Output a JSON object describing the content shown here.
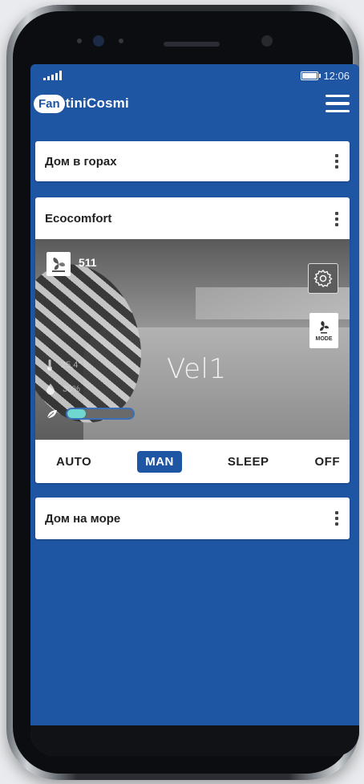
{
  "status_bar": {
    "time": "12:06"
  },
  "app": {
    "logo_badge": "Fan",
    "logo_rest": "tiniCosmi"
  },
  "homes": [
    {
      "name": "Дом в горах"
    },
    {
      "name": "Дом на море"
    }
  ],
  "device": {
    "name": "Ecocomfort",
    "fan_id": "511",
    "temperature": "25.4°",
    "humidity": "30%",
    "speed_label": "Vel1",
    "mode_button_label": "MODE",
    "eco_level": 0.28
  },
  "modes": [
    {
      "label": "AUTO",
      "active": false
    },
    {
      "label": "MAN",
      "active": true
    },
    {
      "label": "SLEEP",
      "active": false
    },
    {
      "label": "OFF",
      "active": false
    }
  ],
  "colors": {
    "primary": "#1e56a4",
    "eco_fill": "#6fd7cf"
  }
}
